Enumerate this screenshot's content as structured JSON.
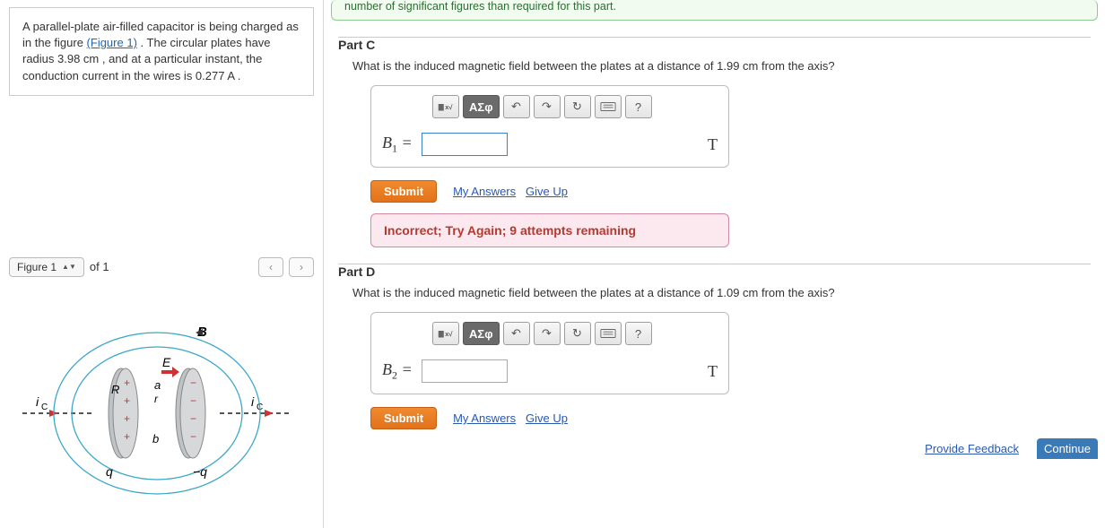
{
  "problem": {
    "text_prefix": "A parallel-plate air-filled capacitor is being charged as in the figure ",
    "figure_link": "(Figure 1)",
    "text_suffix": " . The circular plates have radius 3.98 cm , and at a particular instant, the conduction current in the wires is 0.277 A ."
  },
  "figure_nav": {
    "selector_label": "Figure 1",
    "of_label": "of 1"
  },
  "sig_note": "number of significant figures than required for this part.",
  "partC": {
    "header": "Part C",
    "question": "What is the induced magnetic field between the plates at a distance of 1.99 cm from the axis?",
    "var_label": "B",
    "var_sub": "1",
    "equals": " = ",
    "unit": "T",
    "toolbar": {
      "greek": "ΑΣφ",
      "help": "?"
    },
    "submit": "Submit",
    "my_answers": "My Answers",
    "give_up": "Give Up",
    "feedback": "Incorrect; Try Again; 9 attempts remaining"
  },
  "partD": {
    "header": "Part D",
    "question": "What is the induced magnetic field between the plates at a distance of 1.09 cm from the axis?",
    "var_label": "B",
    "var_sub": "2",
    "equals": " = ",
    "unit": "T",
    "toolbar": {
      "greek": "ΑΣφ",
      "help": "?"
    },
    "submit": "Submit",
    "my_answers": "My Answers",
    "give_up": "Give Up"
  },
  "footer": {
    "provide_feedback": "Provide Feedback",
    "continue": "Continue"
  }
}
